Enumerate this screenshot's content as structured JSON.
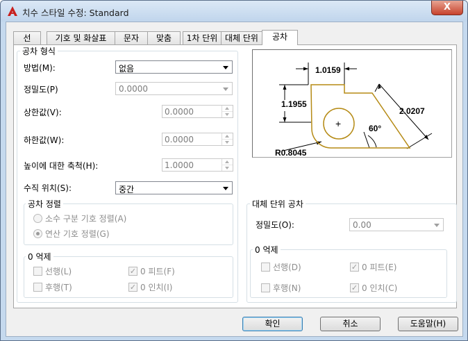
{
  "window": {
    "title": "치수 스타일 수정: Standard",
    "close_label": "X"
  },
  "tabs": [
    {
      "label": "선"
    },
    {
      "label": "기호 및 화살표"
    },
    {
      "label": "문자"
    },
    {
      "label": "맞춤"
    },
    {
      "label": "1차 단위"
    },
    {
      "label": "대체 단위"
    },
    {
      "label": "공차",
      "active": true
    }
  ],
  "tolerance_format": {
    "group_label": "공차 형식",
    "method": {
      "label": "방법(M):",
      "value": "없음"
    },
    "precision": {
      "label": "정밀도(P)",
      "value": "0.0000"
    },
    "upper_value": {
      "label": "상한값(V):",
      "value": "0.0000"
    },
    "lower_value": {
      "label": "하한값(W):",
      "value": "0.0000"
    },
    "height_scale": {
      "label": "높이에 대한 축척(H):",
      "value": "1.0000"
    },
    "vertical_position": {
      "label": "수직 위치(S):",
      "value": "중간"
    },
    "alignment": {
      "group_label": "공차 정렬",
      "decimal_separators": "소수 구분 기호 정렬(A)",
      "operational_symbols": "연산 기호 정렬(G)",
      "selected": "operational_symbols"
    },
    "zero_suppression": {
      "group_label": "0 억제",
      "leading": {
        "label": "선행(L)",
        "checked": false
      },
      "trailing": {
        "label": "후행(T)",
        "checked": false
      },
      "zero_feet": {
        "label": "0 피트(F)",
        "checked": true
      },
      "zero_inches": {
        "label": "0 인치(I)",
        "checked": true
      }
    }
  },
  "preview": {
    "dim_top": "1.0159",
    "dim_left": "1.1955",
    "dim_right": "2.0207",
    "angle": "60°",
    "radius": "R0.8045",
    "center_mark": "+"
  },
  "alt_unit_tolerance": {
    "group_label": "대체 단위 공차",
    "precision": {
      "label": "정밀도(O):",
      "value": "0.00"
    },
    "zero_suppression": {
      "group_label": "0 억제",
      "leading": {
        "label": "선행(D)",
        "checked": false
      },
      "trailing": {
        "label": "후행(N)",
        "checked": false
      },
      "zero_feet": {
        "label": "0 피트(E)",
        "checked": true
      },
      "zero_inches": {
        "label": "0 인치(C)",
        "checked": true
      }
    }
  },
  "buttons": {
    "ok": "확인",
    "cancel": "취소",
    "help": "도움말(H)"
  },
  "colors": {
    "preview_outline": "#b58a14",
    "title_icon": "#c8201e"
  }
}
